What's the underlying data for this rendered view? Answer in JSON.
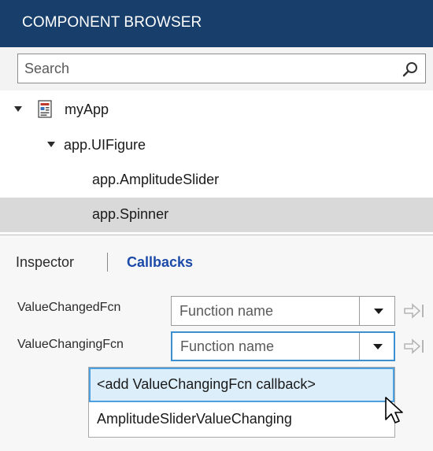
{
  "header": {
    "title": "COMPONENT BROWSER"
  },
  "search": {
    "placeholder": "Search",
    "icon": "search-icon"
  },
  "tree": {
    "root": {
      "label": "myApp",
      "icon": "app-file-icon",
      "expanded": true
    },
    "figure": {
      "label": "app.UIFigure",
      "expanded": true
    },
    "children": [
      {
        "label": "app.AmplitudeSlider",
        "selected": false
      },
      {
        "label": "app.Spinner",
        "selected": true
      }
    ]
  },
  "tabs": {
    "inspector": "Inspector",
    "callbacks": "Callbacks",
    "active": "Callbacks"
  },
  "callbacks": [
    {
      "name": "ValueChangedFcn",
      "placeholder": "Function name",
      "focused": false
    },
    {
      "name": "ValueChangingFcn",
      "placeholder": "Function name",
      "focused": true
    }
  ],
  "dropdown": {
    "options": [
      {
        "label": "<add ValueChangingFcn callback>",
        "highlighted": true
      },
      {
        "label": "AmplitudeSliderValueChanging",
        "highlighted": false
      }
    ]
  },
  "colors": {
    "header_bg": "#183f6c",
    "active_tab": "#1c4aa8",
    "selected_row": "#d9d9d9",
    "focus_border": "#3c8fd1",
    "dropdown_highlight": "#dceefa"
  }
}
